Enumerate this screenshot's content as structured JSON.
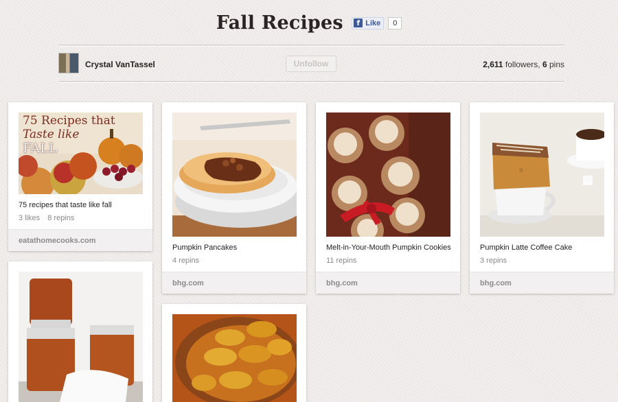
{
  "board": {
    "title": "Fall Recipes",
    "facebook": {
      "like_label": "Like",
      "like_count": "0"
    }
  },
  "owner": {
    "name": "Crystal VanTassel",
    "unfollow_label": "Unfollow",
    "followers": "2,611",
    "followers_label": "followers,",
    "pins": "6",
    "pins_label": "pins"
  },
  "pins": [
    {
      "image_text": [
        "75 Recipes that",
        "Taste like",
        "FALL"
      ],
      "description": "75 recipes that taste like fall",
      "likes": "3 likes",
      "repins": "8 repins",
      "source": "eatathomecooks.com"
    },
    {
      "description": "Pumpkin Pancakes",
      "repins": "4 repins",
      "source": "bhg.com"
    },
    {
      "description": "Melt-in-Your-Mouth Pumpkin Cookies",
      "repins": "11 repins",
      "source": "bhg.com"
    },
    {
      "description": "Pumpkin Latte Coffee Cake",
      "repins": "3 repins",
      "source": "bhg.com"
    },
    {
      "description": "",
      "source": ""
    },
    {
      "description": "",
      "source": ""
    }
  ]
}
